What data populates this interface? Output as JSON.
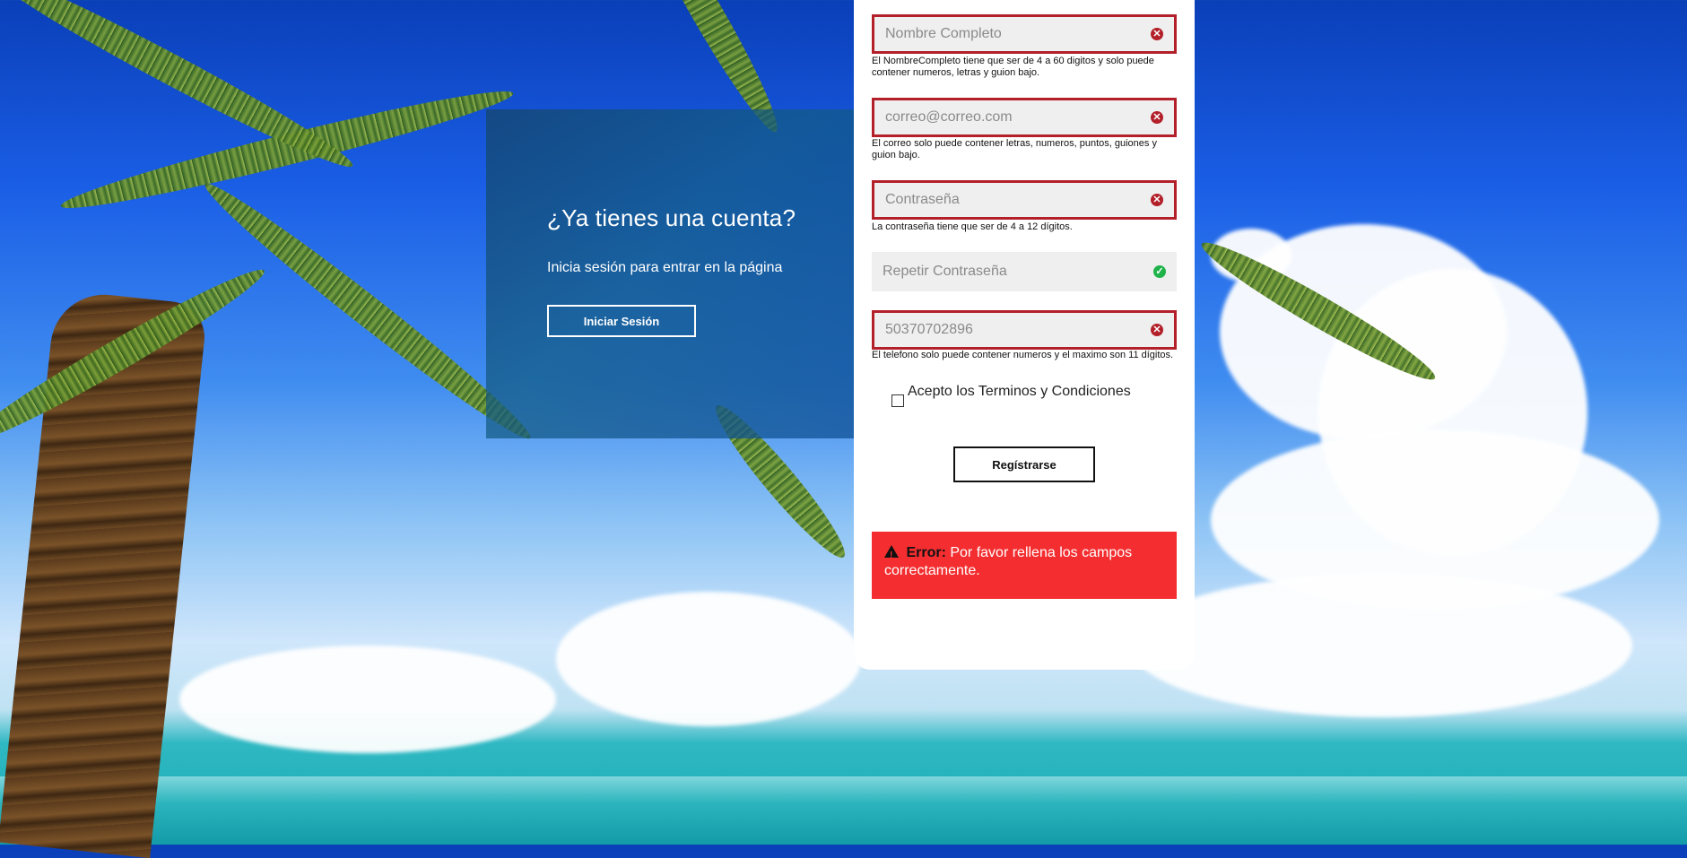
{
  "login_panel": {
    "title": "¿Ya tienes una cuenta?",
    "subtitle": "Inicia sesión para entrar en la página",
    "button_label": "Iniciar Sesión"
  },
  "register_form": {
    "fields": [
      {
        "name": "nombre",
        "value": "Nombre Completo",
        "status": "error",
        "hint": "El NombreCompleto tiene que ser de 4 a 60 digitos y solo puede contener numeros, letras y guion bajo."
      },
      {
        "name": "correo",
        "value": "correo@correo.com",
        "status": "error",
        "hint": "El correo solo puede contener letras, numeros, puntos, guiones y guion bajo."
      },
      {
        "name": "contrasena",
        "value": "Contraseña",
        "status": "error",
        "hint": "La contraseña tiene que ser de 4 a 12 dígitos."
      },
      {
        "name": "repetir",
        "value": "Repetir Contraseña",
        "status": "valid",
        "hint": ""
      },
      {
        "name": "telefono",
        "value": "50370702896",
        "status": "error",
        "hint": "El telefono solo puede contener numeros y el maximo son 11 dígitos."
      }
    ],
    "terms_label": "Acepto los Terminos y Condiciones",
    "terms_checked": false,
    "submit_label": "Regístrarse",
    "error": {
      "label": "Error:",
      "message": "Por favor rellena los campos correctamente."
    }
  },
  "colors": {
    "error_border": "#b3202a",
    "valid_icon": "#1fb34a",
    "alert_bg": "#f42e30"
  }
}
